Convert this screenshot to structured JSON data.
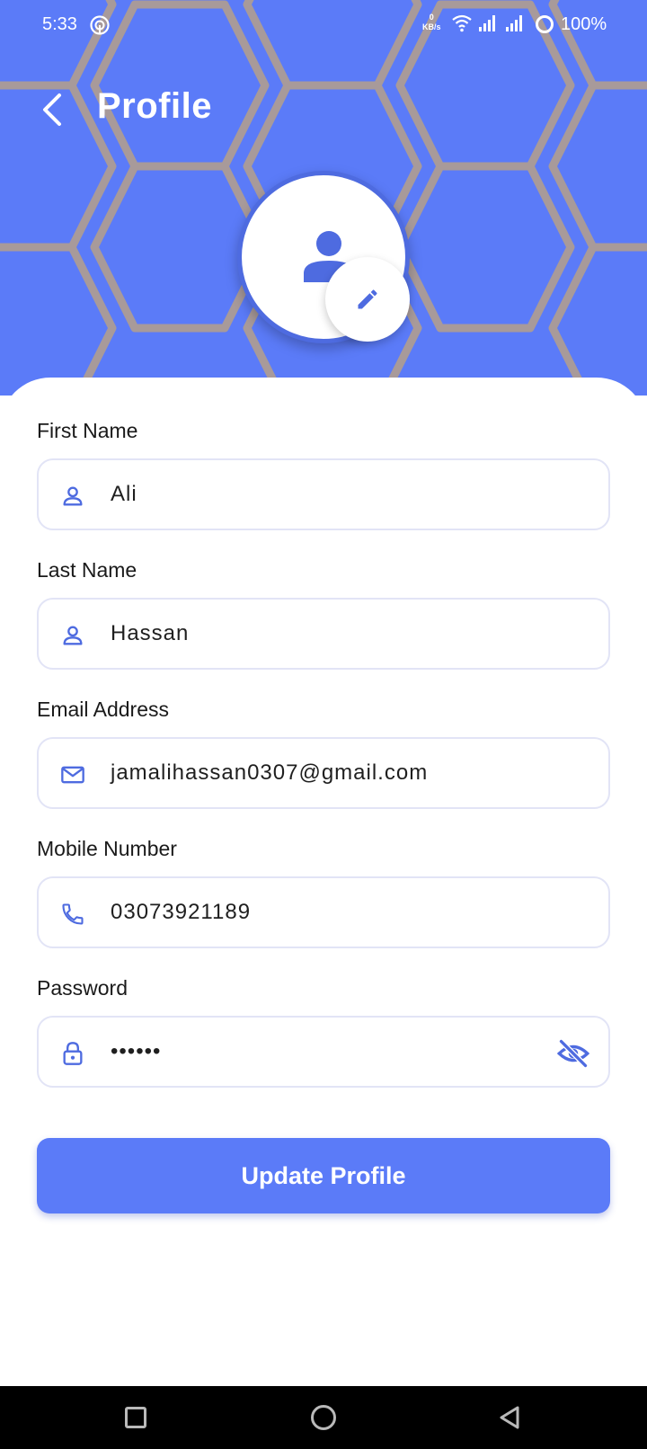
{
  "status_bar": {
    "time": "5:33",
    "kbs_value": "0",
    "kbs_unit": "KB/s",
    "battery": "100%"
  },
  "header": {
    "title": "Profile"
  },
  "form": {
    "first_name": {
      "label": "First Name",
      "value": "Ali",
      "icon": "person-icon"
    },
    "last_name": {
      "label": "Last Name",
      "value": "Hassan",
      "icon": "person-icon"
    },
    "email": {
      "label": "Email Address",
      "value": "jamalihassan0307@gmail.com",
      "icon": "mail-icon"
    },
    "mobile": {
      "label": "Mobile Number",
      "value": "03073921189",
      "icon": "phone-icon"
    },
    "password": {
      "label": "Password",
      "value": "••••••",
      "icon": "lock-icon",
      "toggle_icon": "eye-off-icon"
    }
  },
  "actions": {
    "update_label": "Update Profile"
  },
  "colors": {
    "primary": "#5b7bf8",
    "hex_stroke": "#a89a9a",
    "field_border": "#e2e4f6",
    "icon": "#4e6be0"
  }
}
